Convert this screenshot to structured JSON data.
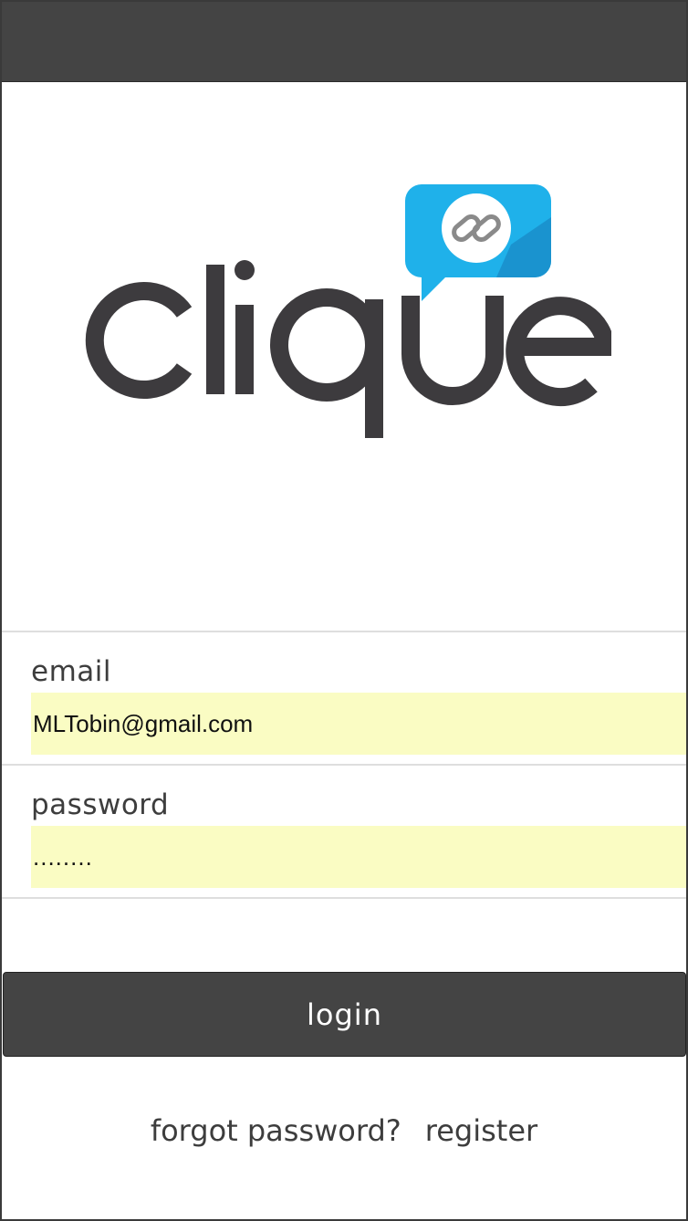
{
  "app": {
    "logo_text": "clique"
  },
  "form": {
    "email_label": "email",
    "email_value": "MLTobin@gmail.com",
    "password_label": "password",
    "password_value": "........"
  },
  "actions": {
    "login_label": "login",
    "forgot_label": "forgot password?",
    "register_label": "register"
  },
  "colors": {
    "bar": "#444444",
    "input_bg": "#fafcc3",
    "logo_text": "#3d3b3e",
    "bubble": "#1fb1ea",
    "bubble_shadow": "#1a93cf"
  },
  "icons": {
    "logo_bubble": "chain-link-icon"
  }
}
